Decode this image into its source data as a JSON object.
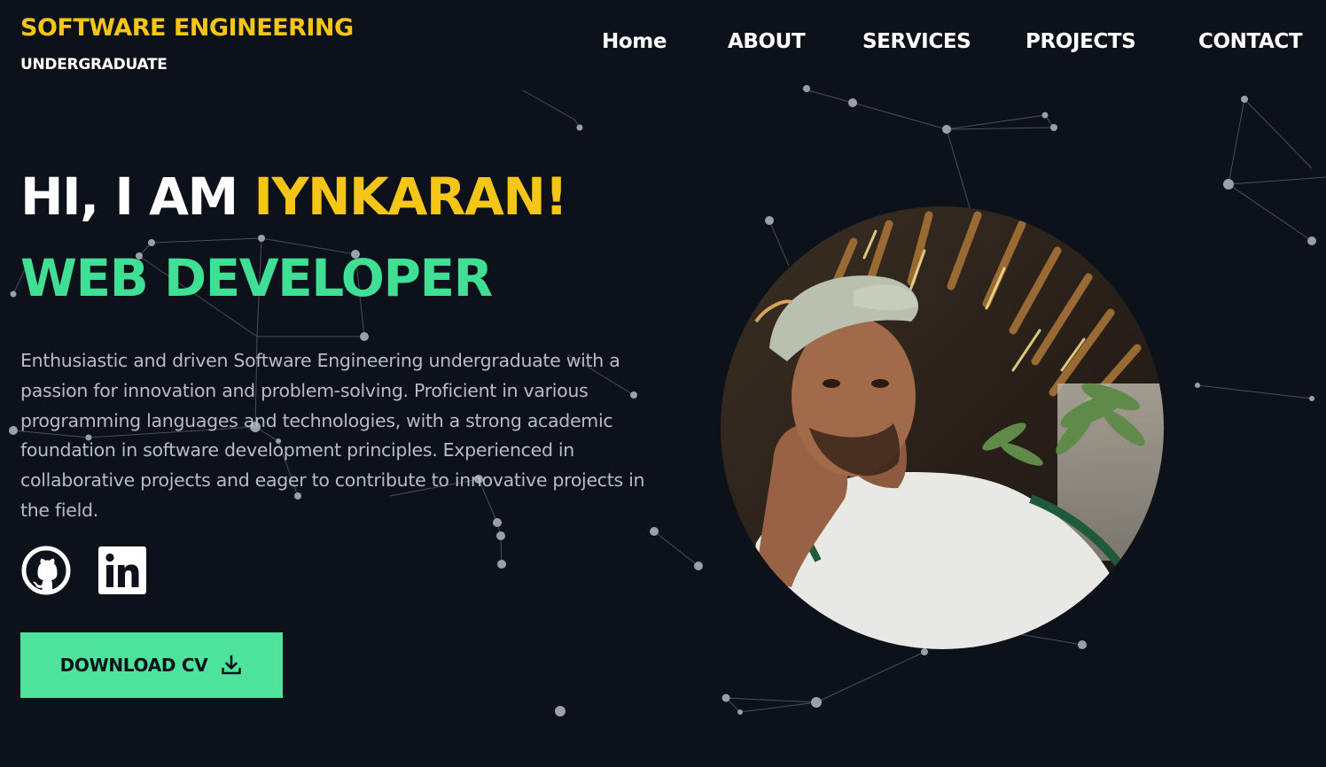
{
  "header": {
    "brand_title": "SOFTWARE ENGINEERING",
    "brand_subtitle": "UNDERGRADUATE"
  },
  "nav": {
    "items": [
      {
        "label": "Home"
      },
      {
        "label": "ABOUT"
      },
      {
        "label": "SERVICES"
      },
      {
        "label": "PROJECTS"
      },
      {
        "label": "CONTACT"
      }
    ]
  },
  "hero": {
    "greeting_prefix": "HI, I AM ",
    "name": "IYNKARAN!",
    "role": "WEB DEVELOPER",
    "bio": "Enthusiastic and driven Software Engineering undergraduate with a passion for innovation and problem-solving. Proficient in various programming languages and technologies, with a strong academic foundation in software development principles. Experienced in collaborative projects and eager to contribute to innovative projects in the field.",
    "download_label": "DOWNLOAD CV"
  },
  "social": [
    {
      "icon": "github-icon"
    },
    {
      "icon": "linkedin-icon"
    }
  ],
  "colors": {
    "background": "#0d111a",
    "accent_yellow": "#f5c518",
    "accent_green": "#3fdf96",
    "button_green": "#4de39c",
    "body_text": "#b8bcc4"
  }
}
